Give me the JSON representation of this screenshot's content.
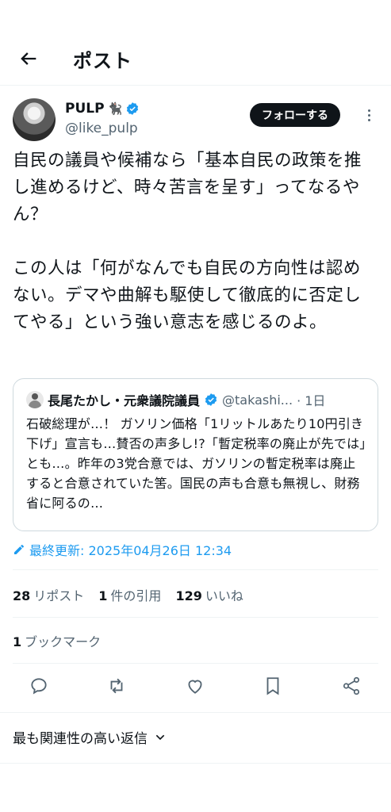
{
  "header": {
    "title": "ポスト"
  },
  "author": {
    "name": "PULP",
    "emoji": "🐈‍⬛",
    "handle": "@like_pulp",
    "follow_label": "フォローする"
  },
  "post": {
    "text": "自民の議員や候補なら「基本自民の政策を推し進めるけど、時々苦言を呈す」ってなるやん？\n\nこの人は「何がなんでも自民の方向性は認めない。デマや曲解も駆使して徹底的に否定してやる」という強い意志を感じるのよ。"
  },
  "quote": {
    "name": "長尾たかし・元衆議院議員",
    "handle": "@takashi...",
    "time": "· 1日",
    "text": "石破総理が…！ ガソリン価格「1リットルあたり10円引き下げ」宣言も…賛否の声多し!?「暫定税率の廃止が先では」とも…。昨年の3党合意では、ガソリンの暫定税率は廃止すると合意されていた筈。国民の声も合意も無視し、財務省に阿るの…"
  },
  "edited": {
    "label": "最終更新: 2025年04月26日 12:34"
  },
  "stats": {
    "reposts_count": "28",
    "reposts_label": "リポスト",
    "quotes_count": "1",
    "quotes_label": "件の引用",
    "likes_count": "129",
    "likes_label": "いいね"
  },
  "bookmarks": {
    "count": "1",
    "label": "ブックマーク"
  },
  "actions": [
    "reply-icon",
    "repost-icon",
    "like-icon",
    "bookmark-icon",
    "share-icon"
  ],
  "sort": {
    "label": "最も関連性の高い返信"
  },
  "colors": {
    "accent": "#1d9bf0",
    "text": "#0f1419",
    "muted": "#536471",
    "border": "#cfd9de"
  }
}
